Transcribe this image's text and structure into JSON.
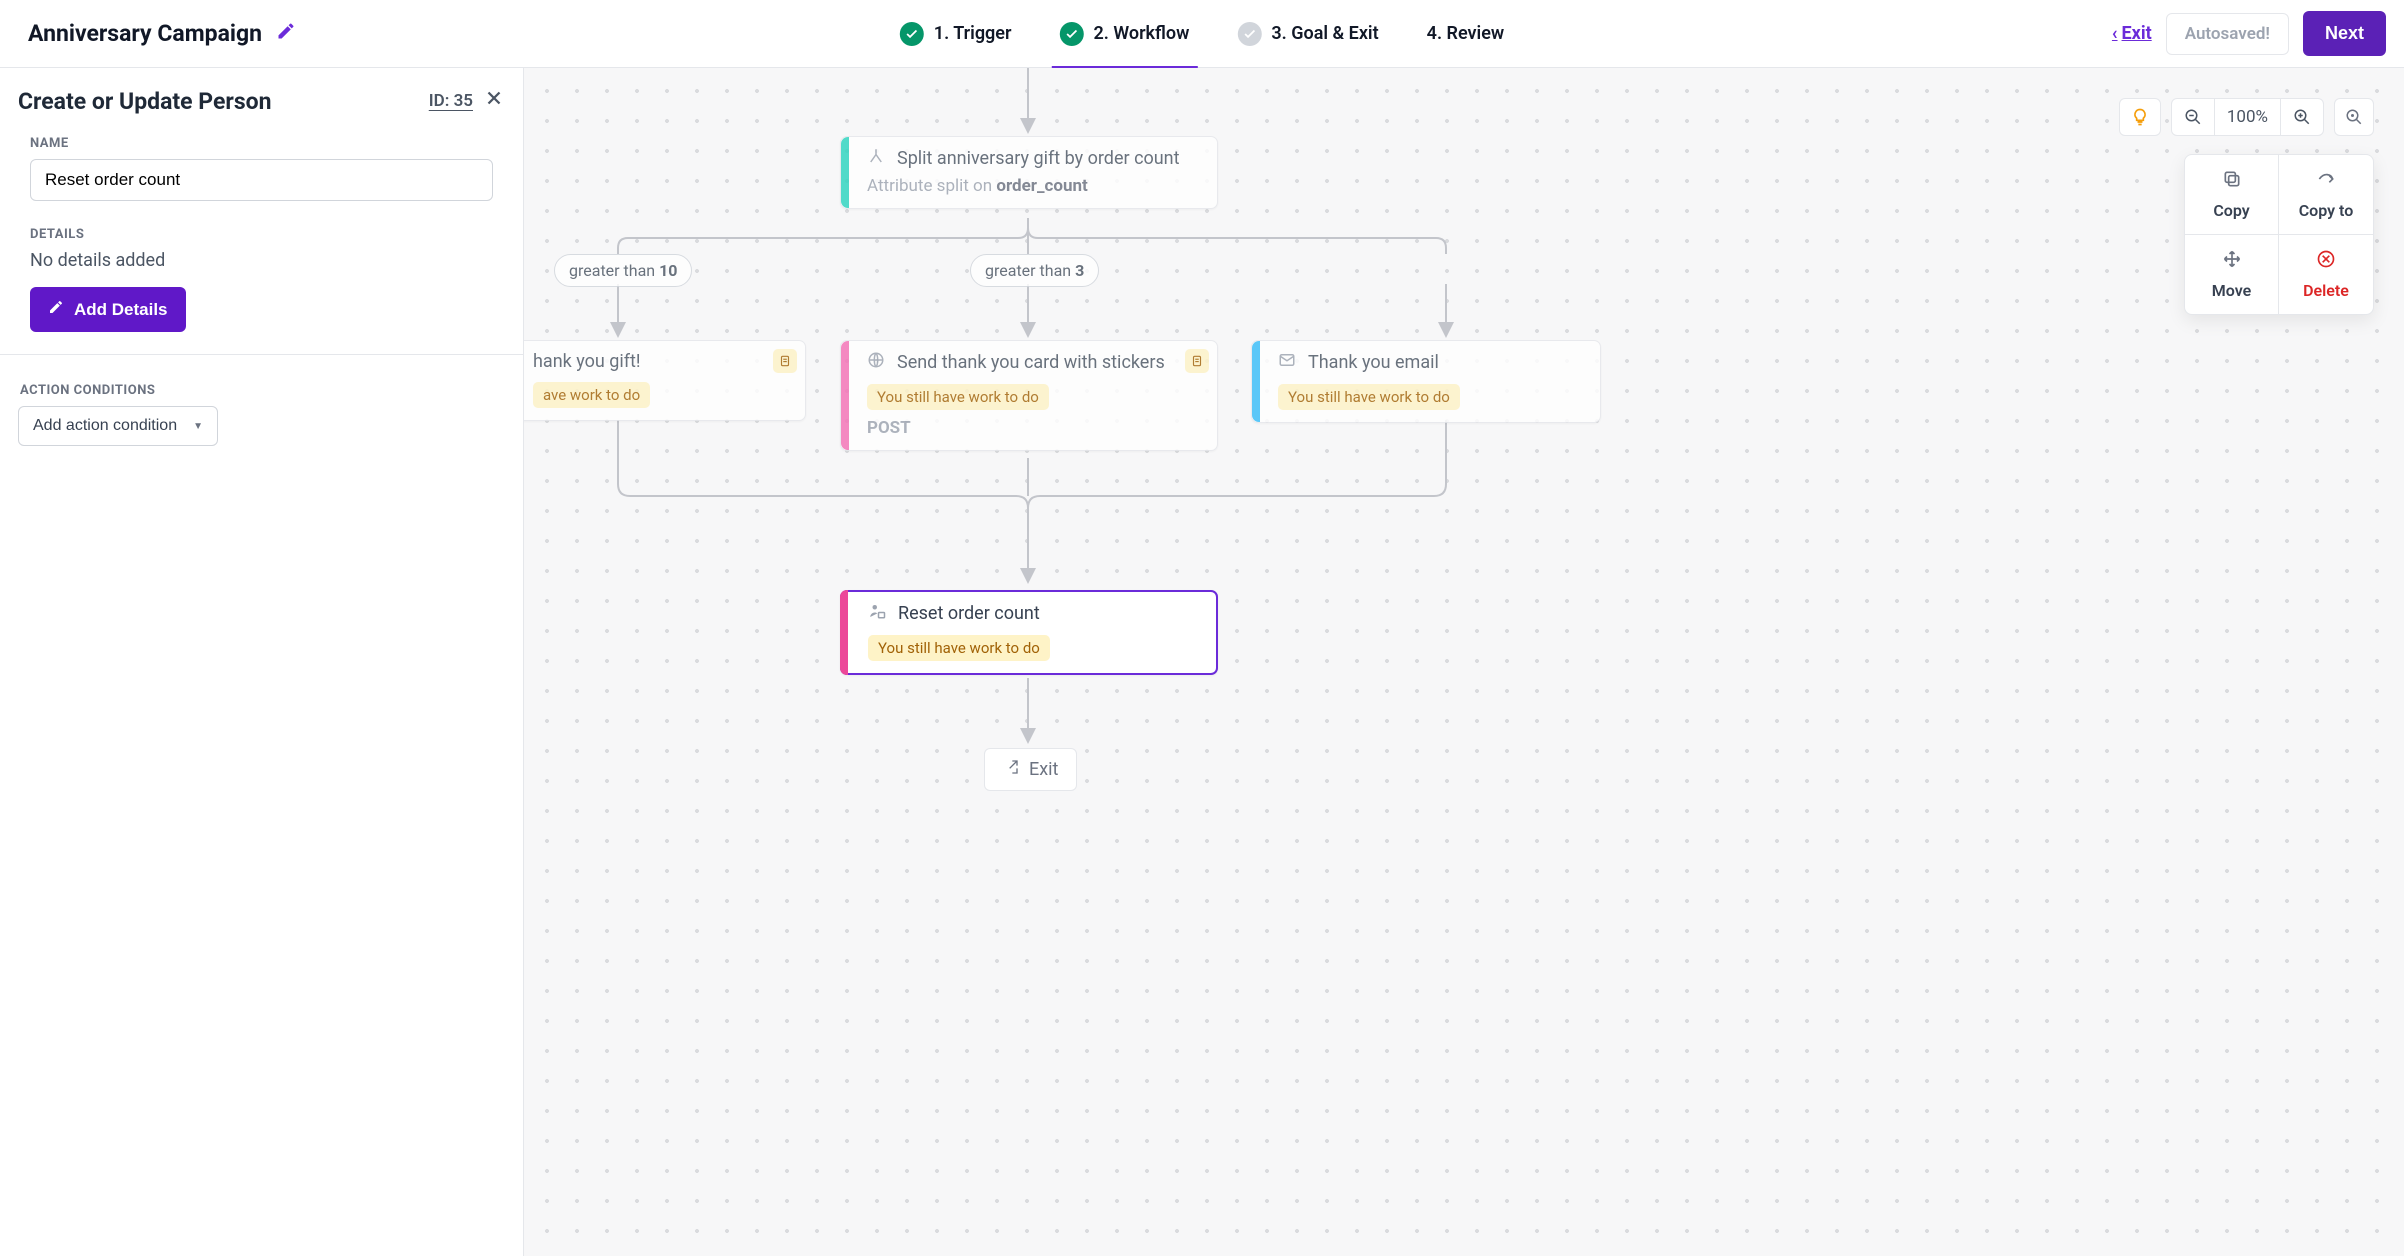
{
  "header": {
    "title": "Anniversary Campaign",
    "steps": [
      {
        "label": "1. Trigger",
        "state": "done"
      },
      {
        "label": "2. Workflow",
        "state": "done",
        "active": true
      },
      {
        "label": "3. Goal & Exit",
        "state": "plain"
      },
      {
        "label": "4. Review",
        "state": "none"
      }
    ],
    "exit": "Exit",
    "autosaved": "Autosaved!",
    "next": "Next"
  },
  "panel": {
    "title": "Create or Update Person",
    "id_label": "ID: 35",
    "name_label": "NAME",
    "name_value": "Reset order count",
    "details_label": "DETAILS",
    "details_value": "No details added",
    "add_details": "Add Details",
    "conditions_label": "ACTION CONDITIONS",
    "add_condition": "Add action condition"
  },
  "zoom": {
    "value": "100%"
  },
  "context_menu": {
    "copy": "Copy",
    "copy_to": "Copy to",
    "move": "Move",
    "delete": "Delete"
  },
  "nodes": {
    "split": {
      "title": "Split anniversary gift by order count",
      "sub_prefix": "Attribute split on ",
      "sub_attr": "order_count",
      "accent": "#2DD4BF"
    },
    "pill_gt10": "greater than 10",
    "pill_gt3": "greater than 3",
    "gift": {
      "title_fragment": "hank you gift!",
      "warn_fragment": "ave work to do",
      "accent": "#F472B6"
    },
    "stickers": {
      "title": "Send thank you card with stickers",
      "warn": "You still have work to do",
      "method": "POST",
      "accent": "#F472B6"
    },
    "email": {
      "title": "Thank you email",
      "warn": "You still have work to do",
      "accent": "#38BDF8"
    },
    "reset": {
      "title": "Reset order count",
      "warn": "You still have work to do",
      "accent": "#EC4899"
    },
    "exit": "Exit"
  }
}
